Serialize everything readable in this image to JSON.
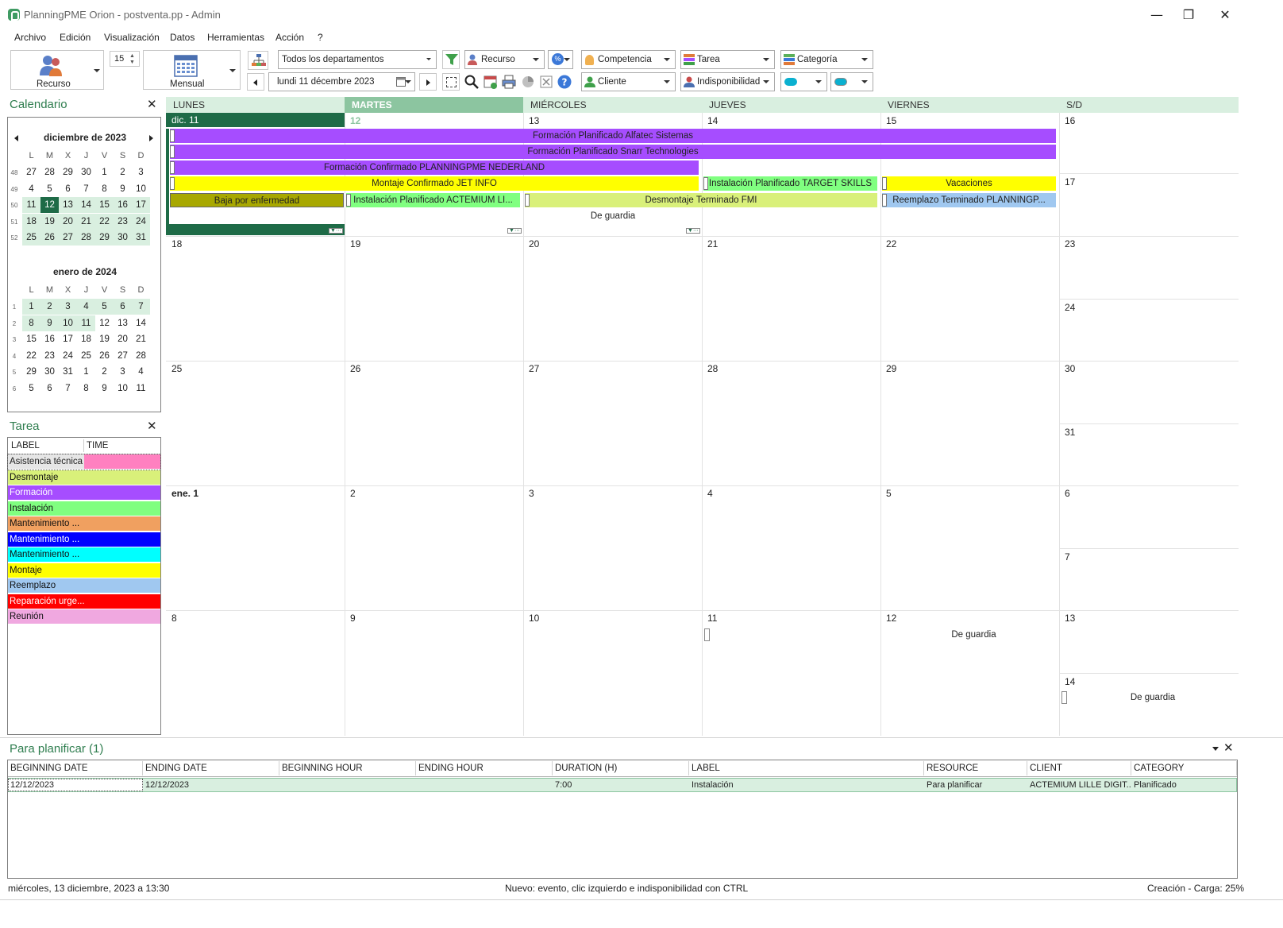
{
  "window": {
    "title": "PlanningPME Orion - postventa.pp - Admin",
    "minimize": "—",
    "restore": "❐",
    "close": "✕"
  },
  "menu": [
    "Archivo",
    "Edición",
    "Visualización",
    "Datos",
    "Herramientas",
    "Acción",
    "?"
  ],
  "toolbar": {
    "view_by_label": "Recurso",
    "count_value": "15",
    "period_label": "Mensual",
    "department": "Todos los departamentos",
    "resource_combo": "Recurso",
    "date_value": "lundi     11  décembre  2023",
    "competencia": "Competencia",
    "tarea": "Tarea",
    "categoria": "Categoría",
    "cliente": "Cliente",
    "indisponibilidad": "Indisponibilidad"
  },
  "calendar_panel": {
    "title": "Calendario",
    "weekdays": [
      "L",
      "M",
      "X",
      "J",
      "V",
      "S",
      "D"
    ],
    "months": [
      {
        "name": "diciembre de 2023",
        "weeks": [
          {
            "wk": "48",
            "days": [
              "27",
              "28",
              "29",
              "30",
              "1",
              "2",
              "3"
            ]
          },
          {
            "wk": "49",
            "days": [
              "4",
              "5",
              "6",
              "7",
              "8",
              "9",
              "10"
            ]
          },
          {
            "wk": "50",
            "days": [
              "11",
              "12",
              "13",
              "14",
              "15",
              "16",
              "17"
            ]
          },
          {
            "wk": "51",
            "days": [
              "18",
              "19",
              "20",
              "21",
              "22",
              "23",
              "24"
            ]
          },
          {
            "wk": "52",
            "days": [
              "25",
              "26",
              "27",
              "28",
              "29",
              "30",
              "31"
            ]
          }
        ]
      },
      {
        "name": "enero de 2024",
        "weeks": [
          {
            "wk": "1",
            "days": [
              "1",
              "2",
              "3",
              "4",
              "5",
              "6",
              "7"
            ]
          },
          {
            "wk": "2",
            "days": [
              "8",
              "9",
              "10",
              "11",
              "12",
              "13",
              "14"
            ]
          },
          {
            "wk": "3",
            "days": [
              "15",
              "16",
              "17",
              "18",
              "19",
              "20",
              "21"
            ]
          },
          {
            "wk": "4",
            "days": [
              "22",
              "23",
              "24",
              "25",
              "26",
              "27",
              "28"
            ]
          },
          {
            "wk": "5",
            "days": [
              "29",
              "30",
              "31",
              "1",
              "2",
              "3",
              "4"
            ]
          },
          {
            "wk": "6",
            "days": [
              "5",
              "6",
              "7",
              "8",
              "9",
              "10",
              "11"
            ]
          }
        ]
      }
    ]
  },
  "task_panel": {
    "title": "Tarea",
    "columns": [
      "LABEL",
      "TIME"
    ],
    "tasks": [
      {
        "label": "Asistencia técnica",
        "color": "#ff80c0",
        "text_color": "#222222"
      },
      {
        "label": "Desmontaje",
        "color": "#d9f07a",
        "text_color": "#111111"
      },
      {
        "label": "Formación",
        "color": "#a64dff",
        "text_color": "#ffffff"
      },
      {
        "label": "Instalación",
        "color": "#80ff80",
        "text_color": "#111111"
      },
      {
        "label": "Mantenimiento ...",
        "color": "#f0a060",
        "text_color": "#111111"
      },
      {
        "label": "Mantenimiento ...",
        "color": "#0000ff",
        "text_color": "#ffffff"
      },
      {
        "label": "Mantenimiento ...",
        "color": "#00ffff",
        "text_color": "#111111"
      },
      {
        "label": "Montaje",
        "color": "#ffff00",
        "text_color": "#111111"
      },
      {
        "label": "Reemplazo",
        "color": "#a0c8f0",
        "text_color": "#111111"
      },
      {
        "label": "Reparación urge...",
        "color": "#ff0000",
        "text_color": "#ffffff"
      },
      {
        "label": "Reunión",
        "color": "#f0a8e0",
        "text_color": "#111111"
      }
    ]
  },
  "month_view": {
    "headers": [
      "LUNES",
      "MARTES",
      "MIÉRCOLES",
      "JUEVES",
      "VIERNES",
      "S/D"
    ],
    "week1": {
      "days": [
        "dic. 11",
        "12",
        "13",
        "14",
        "15"
      ],
      "sat": "16",
      "sun": "17",
      "events": [
        {
          "label": "Formación Planificado Alfatec Sistemas",
          "color": "#a64dff"
        },
        {
          "label": "Formación Planificado Snarr Technologies",
          "color": "#a64dff"
        },
        {
          "label": "Formación Confirmado PLANNINGPME NEDERLAND",
          "color": "#a64dff"
        },
        {
          "label": "Montaje Confirmado JET INFO",
          "color": "#ffff00"
        },
        {
          "label": "Instalación Planificado TARGET SKILLS",
          "color": "#80ff80"
        },
        {
          "label": "Vacaciones",
          "color": "#ffff00"
        },
        {
          "label": "Baja por enfermedad",
          "color": "#a8a800"
        },
        {
          "label": "Instalación Planificado ACTEMIUM LI...",
          "color": "#80ff80"
        },
        {
          "label": "Desmontaje Terminado FMI",
          "color": "#d9f07a"
        },
        {
          "label": "Reemplazo Terminado PLANNINGP...",
          "color": "#a0c8f0"
        },
        {
          "label": "De guardia",
          "color": "#ffffff"
        }
      ]
    },
    "week2": {
      "days": [
        "18",
        "19",
        "20",
        "21",
        "22"
      ],
      "sat": "23",
      "sun": "24"
    },
    "week3": {
      "days": [
        "25",
        "26",
        "27",
        "28",
        "29"
      ],
      "sat": "30",
      "sun": "31"
    },
    "week4": {
      "days": [
        "ene. 1",
        "2",
        "3",
        "4",
        "5"
      ],
      "sat": "6",
      "sun": "7"
    },
    "week5": {
      "days": [
        "8",
        "9",
        "10",
        "11",
        "12"
      ],
      "sat": "13",
      "sun": "14",
      "fri_event": "De guardia",
      "sun_event": "De guardia"
    }
  },
  "to_plan": {
    "title": "Para planificar (1)",
    "columns": [
      "BEGINNING DATE",
      "ENDING DATE",
      "BEGINNING HOUR",
      "ENDING HOUR",
      "DURATION (H)",
      "LABEL",
      "RESOURCE",
      "CLIENT",
      "CATEGORY"
    ],
    "rows": [
      [
        "12/12/2023",
        "12/12/2023",
        "",
        "",
        "7:00",
        "Instalación",
        "Para planificar",
        "ACTEMIUM LILLE DIGIT...",
        "Planificado"
      ]
    ]
  },
  "status": {
    "left": "miércoles, 13 diciembre, 2023 a 13:30",
    "center": "Nuevo: evento, clic izquierdo e indisponibilidad con CTRL",
    "right": "Creación - Carga: 25%"
  },
  "colors": {
    "accent_green": "#2e7d4e",
    "selected_day": "#1e6b47",
    "header_bg": "#d9efe0",
    "today_header": "#8cc5a0"
  }
}
